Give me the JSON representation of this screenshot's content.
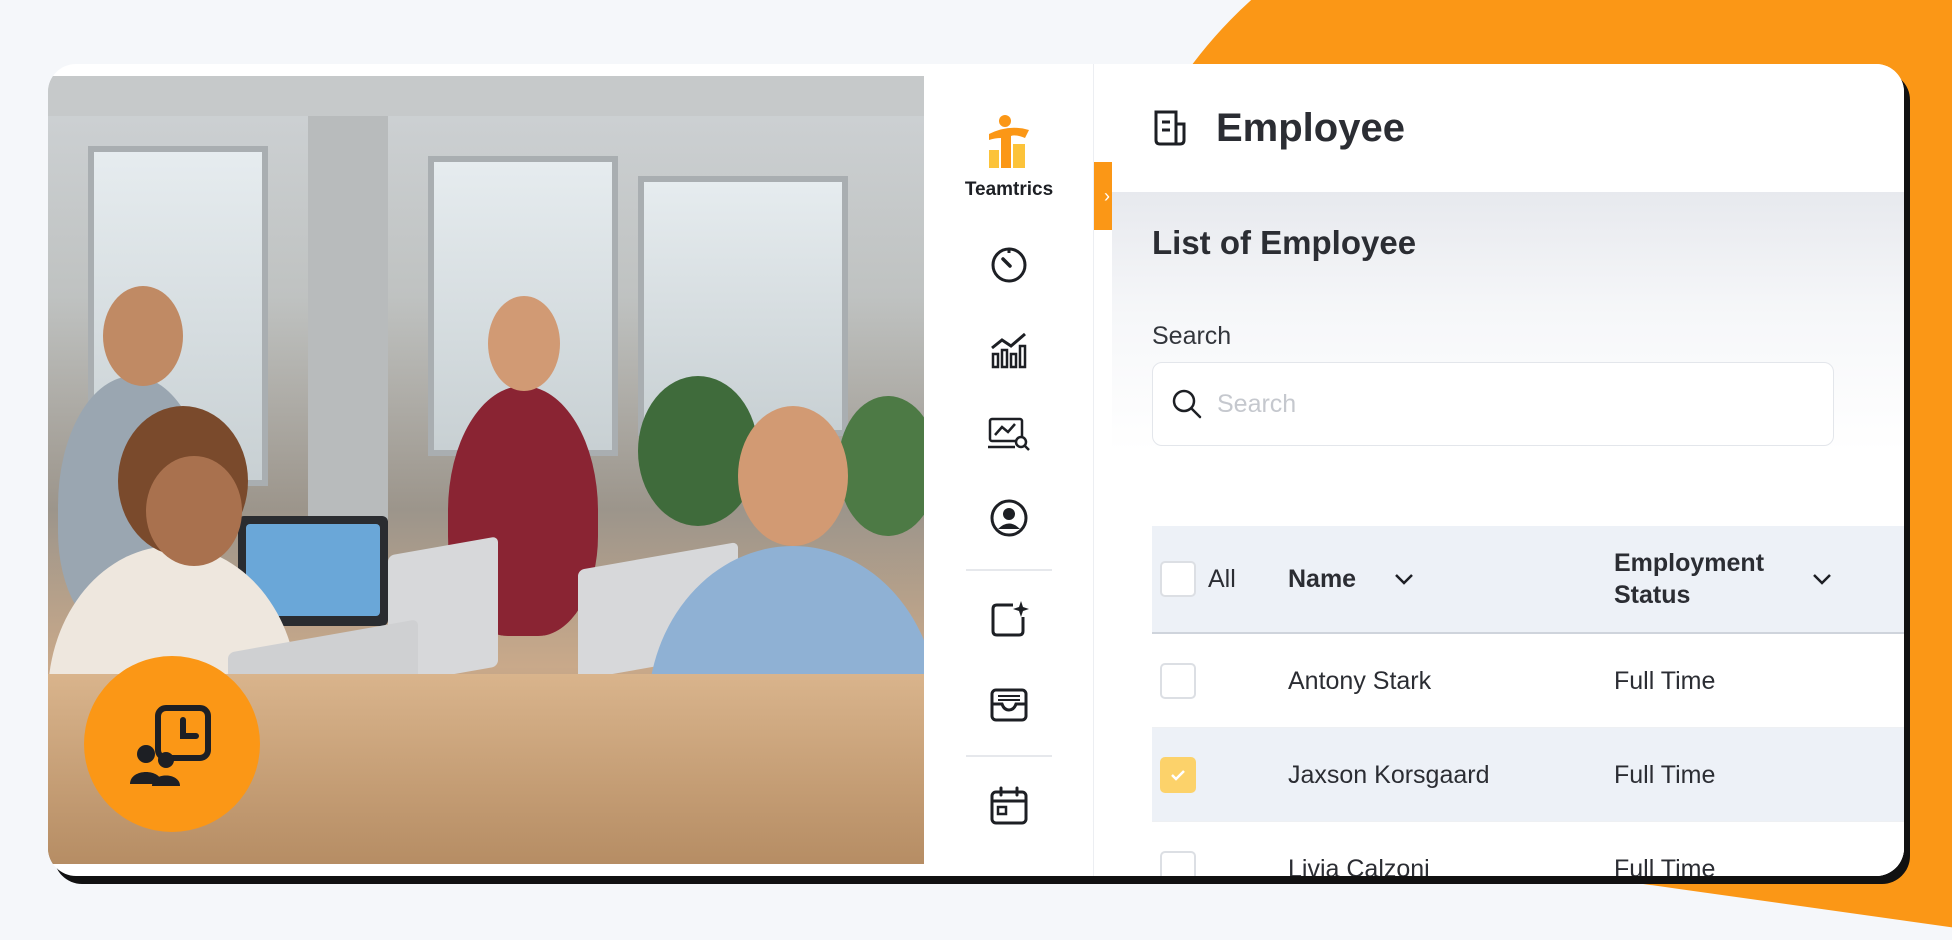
{
  "brand": {
    "name": "Teamtrics",
    "accent_color": "#fb9716"
  },
  "sidebar": {
    "items": [
      {
        "icon": "dashboard-gauge-icon"
      },
      {
        "icon": "analytics-chart-icon"
      },
      {
        "icon": "monitor-search-icon"
      },
      {
        "icon": "user-circle-icon"
      },
      {
        "icon": "add-sparkle-icon"
      },
      {
        "icon": "inbox-icon"
      },
      {
        "icon": "calendar-icon"
      }
    ],
    "collapse_label": "›"
  },
  "header": {
    "title": "Employee",
    "icon": "document-icon"
  },
  "main": {
    "section_title": "List of Employee",
    "search": {
      "label": "Search",
      "placeholder": "Search",
      "value": ""
    },
    "table": {
      "select_all_label": "All",
      "columns": [
        "Name",
        "Employment Status"
      ],
      "rows": [
        {
          "name": "Antony Stark",
          "status": "Full Time",
          "checked": false
        },
        {
          "name": "Jaxson Korsgaard",
          "status": "Full Time",
          "checked": true
        },
        {
          "name": "Livia Calzoni",
          "status": "Full Time",
          "checked": false
        }
      ]
    }
  },
  "badge": {
    "icon": "team-schedule-icon"
  }
}
